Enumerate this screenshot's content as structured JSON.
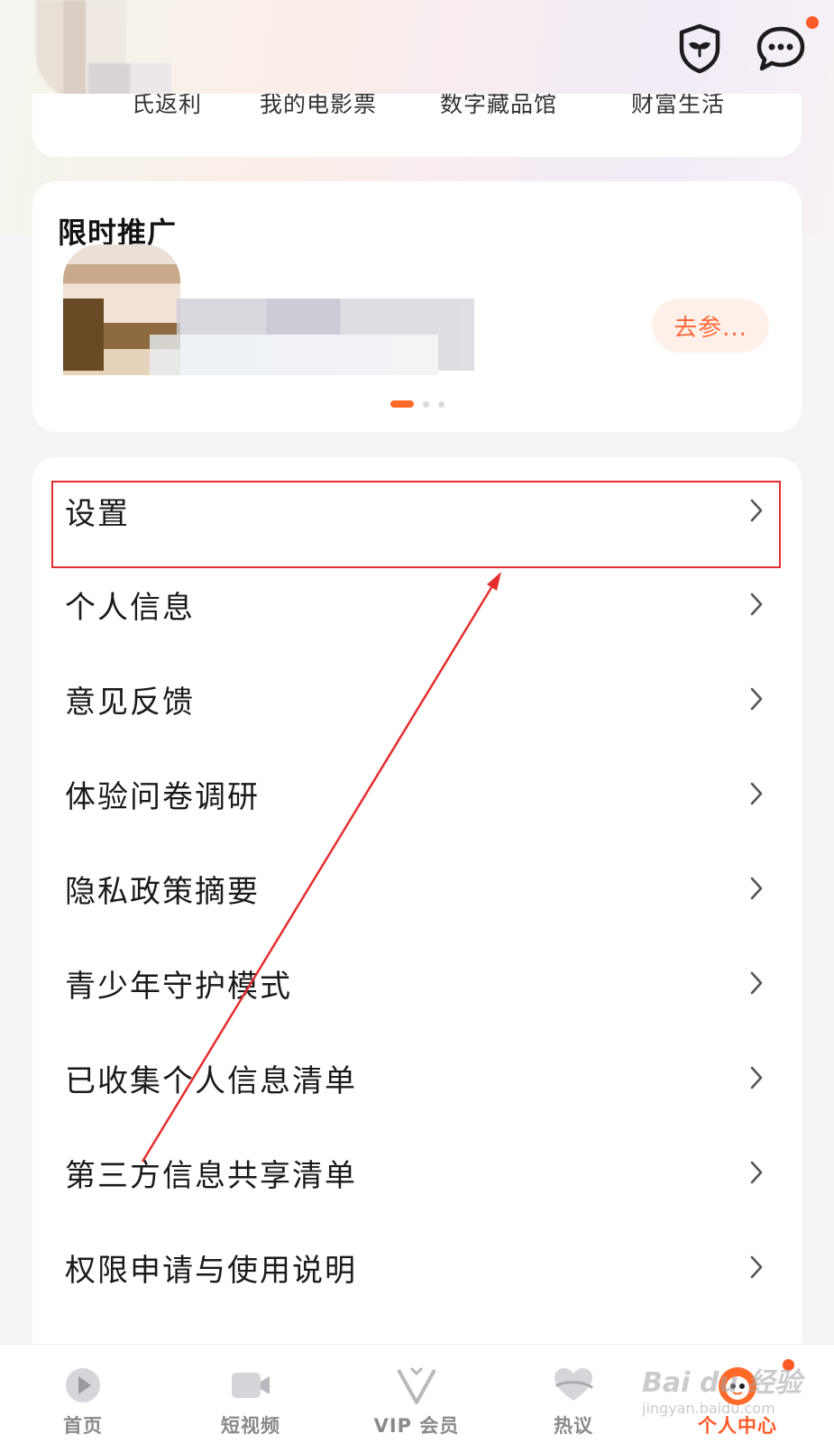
{
  "header": {
    "shield_icon": "shield-sprout-icon",
    "message_icon": "chat-bubble-icon"
  },
  "quick_links": [
    {
      "label": "氏返利"
    },
    {
      "label": "我的电影票"
    },
    {
      "label": "数字藏品馆"
    },
    {
      "label": "财富生活"
    }
  ],
  "promo": {
    "title": "限时推广",
    "button_label": "去参..."
  },
  "menu": [
    {
      "label": "设置"
    },
    {
      "label": "个人信息"
    },
    {
      "label": "意见反馈"
    },
    {
      "label": "体验问卷调研"
    },
    {
      "label": "隐私政策摘要"
    },
    {
      "label": "青少年守护模式"
    },
    {
      "label": "已收集个人信息清单"
    },
    {
      "label": "第三方信息共享清单"
    },
    {
      "label": "权限申请与使用说明"
    }
  ],
  "tabs": [
    {
      "label": "首页",
      "icon": "play-icon"
    },
    {
      "label": "短视频",
      "icon": "video-camera-icon"
    },
    {
      "label": "VIP 会员",
      "icon": "vip-v-icon"
    },
    {
      "label": "热议",
      "icon": "heart-chat-icon"
    },
    {
      "label": "个人中心",
      "icon": "mascot-icon",
      "active": true
    }
  ],
  "watermark": {
    "text": "Bai du 经验",
    "url": "jingyan.baidu.com"
  },
  "colors": {
    "accent": "#ff5a28",
    "annotation": "#e52d2d"
  }
}
